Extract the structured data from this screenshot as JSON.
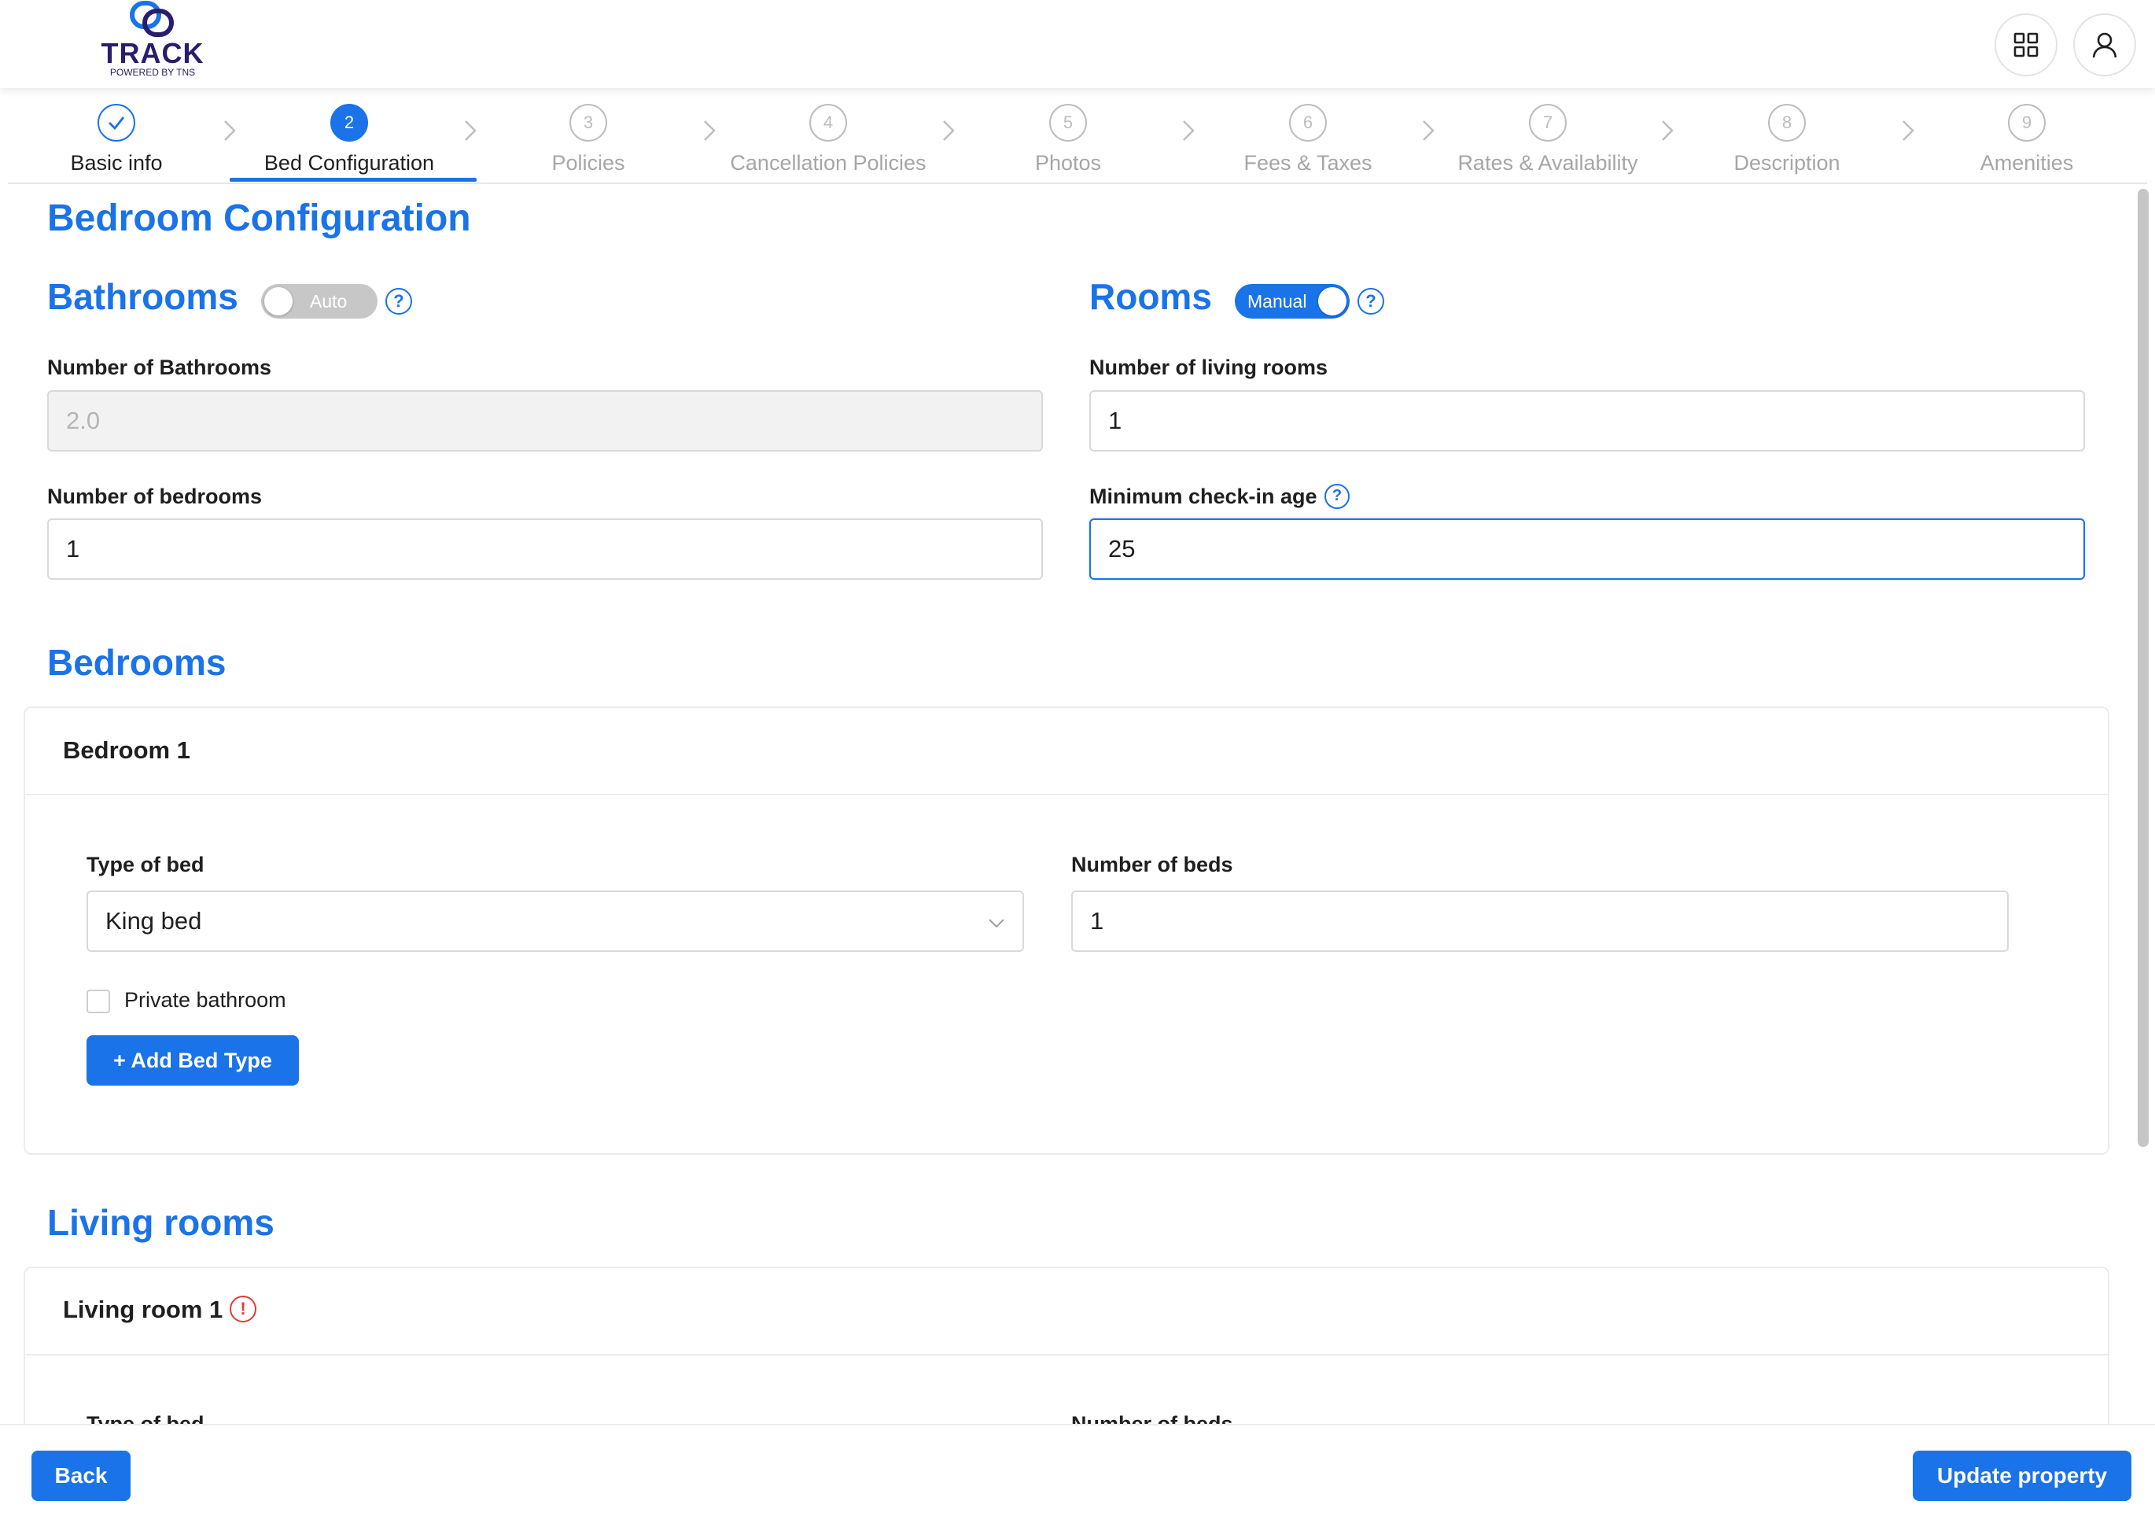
{
  "header": {
    "logo_text": "TRACK",
    "logo_sub": "POWERED BY TNS",
    "apps_icon": "grid-icon",
    "user_icon": "user-icon"
  },
  "steps": [
    {
      "num": "1",
      "label": "Basic info",
      "state": "done"
    },
    {
      "num": "2",
      "label": "Bed Configuration",
      "state": "active"
    },
    {
      "num": "3",
      "label": "Policies",
      "state": "pending"
    },
    {
      "num": "4",
      "label": "Cancellation Policies",
      "state": "pending"
    },
    {
      "num": "5",
      "label": "Photos",
      "state": "pending"
    },
    {
      "num": "6",
      "label": "Fees & Taxes",
      "state": "pending"
    },
    {
      "num": "7",
      "label": "Rates & Availability",
      "state": "pending"
    },
    {
      "num": "8",
      "label": "Description",
      "state": "pending"
    },
    {
      "num": "9",
      "label": "Amenities",
      "state": "pending"
    }
  ],
  "page": {
    "title": "Bedroom Configuration"
  },
  "bathrooms": {
    "title": "Bathrooms",
    "toggle_label": "Auto",
    "help": "?",
    "num_bathrooms_label": "Number of Bathrooms",
    "num_bathrooms_value": "2.0",
    "num_bedrooms_label": "Number of bedrooms",
    "num_bedrooms_value": "1"
  },
  "rooms": {
    "title": "Rooms",
    "toggle_label": "Manual",
    "help": "?",
    "num_living_label": "Number of living rooms",
    "num_living_value": "1",
    "min_age_label": "Minimum check-in age",
    "min_age_help": "?",
    "min_age_value": "25"
  },
  "bedrooms": {
    "title": "Bedrooms",
    "card_title": "Bedroom 1",
    "type_label": "Type of bed",
    "type_value": "King bed",
    "beds_label": "Number of beds",
    "beds_value": "1",
    "private_bath_label": "Private bathroom",
    "add_bed_label": "+ Add Bed Type"
  },
  "living_rooms": {
    "title": "Living rooms",
    "card_title": "Living room 1",
    "warning": "!",
    "type_label": "Type of bed",
    "beds_label": "Number of beds"
  },
  "footer": {
    "back_label": "Back",
    "update_label": "Update property"
  },
  "colors": {
    "accent": "#1a73e8",
    "brand": "#2b1d6b",
    "warning": "#e53935"
  }
}
